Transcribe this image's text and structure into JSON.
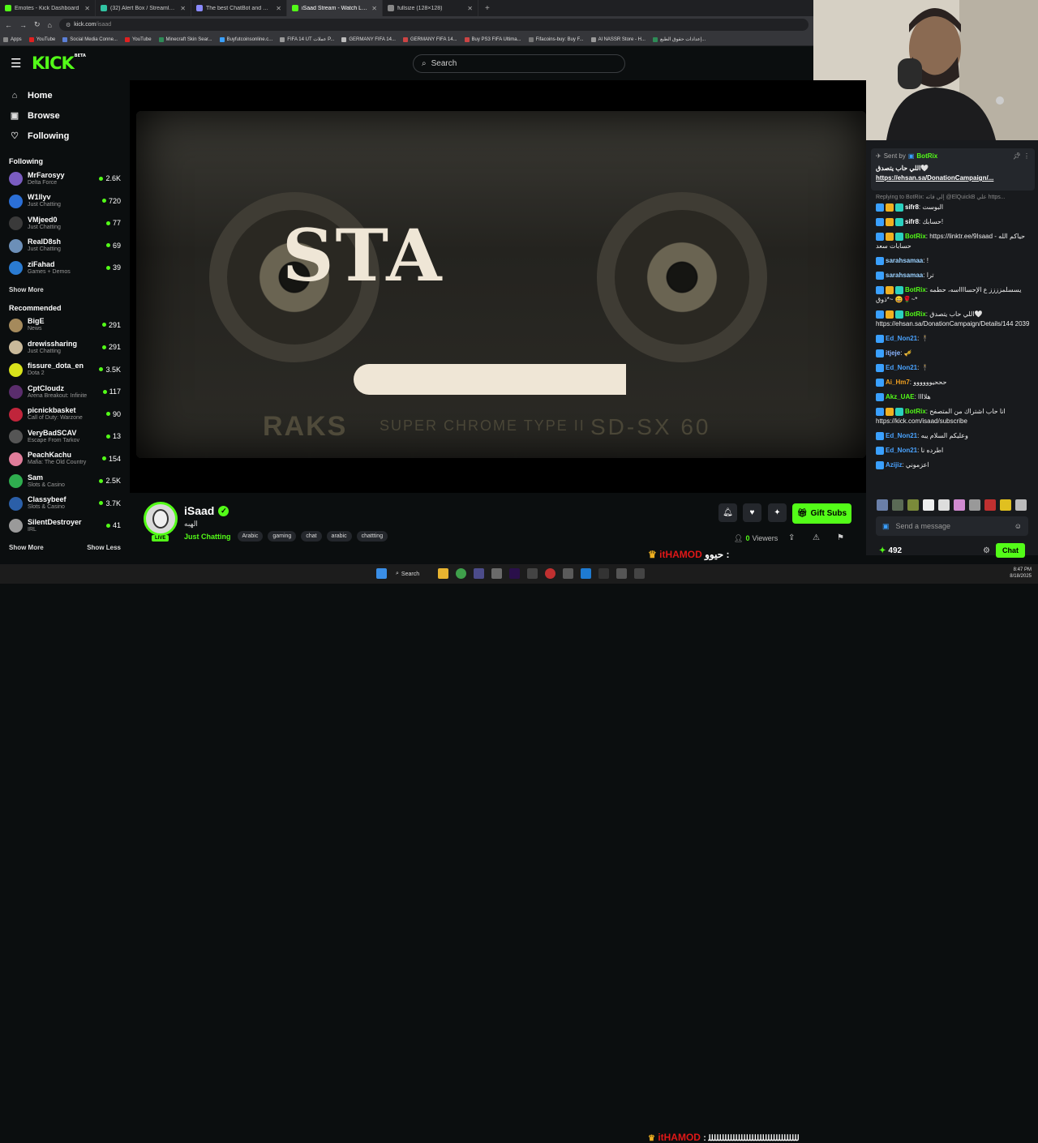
{
  "browser": {
    "tabs": [
      {
        "title": "Emotes - Kick Dashboard",
        "color": "#53fc18"
      },
      {
        "title": "(32) Alert Box / Streamlabs",
        "color": "#31c3a2"
      },
      {
        "title": "The best ChatBot and Widgets",
        "color": "#8a8aff"
      },
      {
        "title": "iSaad Stream - Watch Live on K",
        "color": "#53fc18"
      },
      {
        "title": "fullsize (128×128)",
        "color": "#888888"
      }
    ],
    "address_domain": "kick.com",
    "address_path": "/isaad",
    "bookmarks": [
      "Apps",
      "YouTube",
      "Social Media Conne...",
      "YouTube",
      "Minecraft Skin Sear...",
      "Buyfutcoinsonline.c...",
      "FIFA 14 UT عملات P...",
      "GERMANY FIFA 14...",
      "GERMANY FIFA 14...",
      "Buy PS3 FIFA Ultima...",
      "Fifacoins-buy: Buy F...",
      "Al NASSR Store - H...",
      "إعدادات حقوق الطبع..."
    ]
  },
  "header": {
    "logo": "KICK",
    "logo_sup": "BETA",
    "search_placeholder": "Search"
  },
  "sidebar": {
    "nav": [
      {
        "label": "Home",
        "icon": "home-icon",
        "glyph": "⌂"
      },
      {
        "label": "Browse",
        "icon": "browse-icon",
        "glyph": "▣"
      },
      {
        "label": "Following",
        "icon": "heart-icon",
        "glyph": "♡"
      }
    ],
    "following_title": "Following",
    "following": [
      {
        "name": "MrFarosyy",
        "category": "Delta Force",
        "viewers": "2.6K",
        "color": "#7a5cc0"
      },
      {
        "name": "W1llyv",
        "category": "Just Chatting",
        "viewers": "720",
        "color": "#2b6fd6"
      },
      {
        "name": "VMjeed0",
        "category": "Just Chatting",
        "viewers": "77",
        "color": "#3a3a3a"
      },
      {
        "name": "RealD8sh",
        "category": "Just Chatting",
        "viewers": "69",
        "color": "#6c8fb8"
      },
      {
        "name": "ziFahad",
        "category": "Games + Demos",
        "viewers": "39",
        "color": "#2a7bd1"
      }
    ],
    "show_more": "Show More",
    "recommended_title": "Recommended",
    "recommended": [
      {
        "name": "BigE",
        "category": "News",
        "viewers": "291",
        "color": "#a58a5c"
      },
      {
        "name": "drewissharing",
        "category": "Just Chatting",
        "viewers": "291",
        "color": "#c9b99a"
      },
      {
        "name": "fissure_dota_en",
        "category": "Dota 2",
        "viewers": "3.5K",
        "color": "#d8e21b"
      },
      {
        "name": "CptCloudz",
        "category": "Arena Breakout: Infinite",
        "viewers": "117",
        "color": "#5a2d6c"
      },
      {
        "name": "picnickbasket",
        "category": "Call of Duty: Warzone",
        "viewers": "90",
        "color": "#c0253b"
      },
      {
        "name": "VeryBadSCAV",
        "category": "Escape From Tarkov",
        "viewers": "13",
        "color": "#555555"
      },
      {
        "name": "PeachKachu",
        "category": "Mafia: The Old Country",
        "viewers": "154",
        "color": "#e07d9a"
      },
      {
        "name": "Sam",
        "category": "Slots & Casino",
        "viewers": "2.5K",
        "color": "#2fae4f"
      },
      {
        "name": "Classybeef",
        "category": "Slots & Casino",
        "viewers": "3.7K",
        "color": "#2b5fa8"
      },
      {
        "name": "SilentDestroyer",
        "category": "IRL",
        "viewers": "41",
        "color": "#9a9a9a"
      }
    ],
    "show_more_2": "Show More",
    "show_less": "Show Less"
  },
  "video": {
    "text": "STA",
    "brand": "RAKS",
    "type": "SUPER CHROME TYPE II",
    "model": "SD-SX 60"
  },
  "stream": {
    "name": "iSaad",
    "live_badge": "LIVE",
    "title": "الهبه",
    "category": "Just Chatting",
    "tags": [
      "Arabic",
      "gaming",
      "chat",
      "arabic",
      "chattting"
    ],
    "gift_label": "Gift Subs",
    "viewers_count": "0",
    "viewers_label": "Viewers"
  },
  "overlay": {
    "user1": "itHAMOD",
    "msg1": "حيوو :",
    "user2": "itHAMOD",
    "msg2": ": ﻟﻠﻠﻠﻠﻠﻠﻠﻠﻠﻠﻠﻠﻠﻠﻠﻠﻠﻠﻠﻠﻠﻠﻠﻠﻠﻠﻠﻠﻠﻠﻠﻠﻠ"
  },
  "chat": {
    "pinned": {
      "sent_by": "Sent by",
      "user": "BotRix",
      "message": "اللي حاب يتصدق🤍",
      "link": "https://ehsan.sa/DonationCampaign/..."
    },
    "reply_line": "Replying to BotRix: إلي فاته @ElQuickB علي https...",
    "messages": [
      {
        "user": "sifr8",
        "color": "#ffffff",
        "text": "البوست"
      },
      {
        "user": "sifr8",
        "color": "#ffffff",
        "text": "حسابك!"
      },
      {
        "user": "BotRix",
        "color": "#53fc18",
        "text": "https://linktr.ee/9Isaad - حياكم الله حسابات سعد"
      },
      {
        "user": "sarahsamaa",
        "color": "#9ad1ff",
        "text": "!"
      },
      {
        "user": "sarahsamaa",
        "color": "#9ad1ff",
        "text": "ترا"
      },
      {
        "user": "BotRix",
        "color": "#53fc18",
        "text": "يسسلمزززز ع الإحسااااسه، حطمه ذوق*~ 😄🌹~*"
      },
      {
        "user": "BotRix",
        "color": "#53fc18",
        "text": "اللي حاب يتصدق🤍 https://ehsan.sa/DonationCampaign/Details/144 2039"
      },
      {
        "user": "Ed_Non21",
        "color": "#4aa3ff",
        "text": "🕴"
      },
      {
        "user": "itjeje",
        "color": "#8ab4ff",
        "text": "🎺"
      },
      {
        "user": "Ed_Non21",
        "color": "#4aa3ff",
        "text": "🕴"
      },
      {
        "user": "Ai_Hm7",
        "color": "#f0a020",
        "text": "حححيوووووو"
      },
      {
        "user": "Akz_UAE",
        "color": "#53fc18",
        "text": "هلاااا"
      },
      {
        "user": "BotRix",
        "color": "#53fc18",
        "text": "انا حاب اشتراك من المتصفح https://kick.com/isaad/subscribe"
      },
      {
        "user": "Ed_Non21",
        "color": "#4aa3ff",
        "text": "وعليكم السلام يبه"
      },
      {
        "user": "Ed_Non21",
        "color": "#4aa3ff",
        "text": "اطرده نا"
      },
      {
        "user": "Azijiz",
        "color": "#4aa3ff",
        "text": "اعزموني"
      }
    ],
    "input_placeholder": "Send a message",
    "points": "492",
    "chat_button": "Chat"
  },
  "taskbar": {
    "search_label": "Search",
    "time": "8:47 PM",
    "date": "8/18/2025"
  }
}
